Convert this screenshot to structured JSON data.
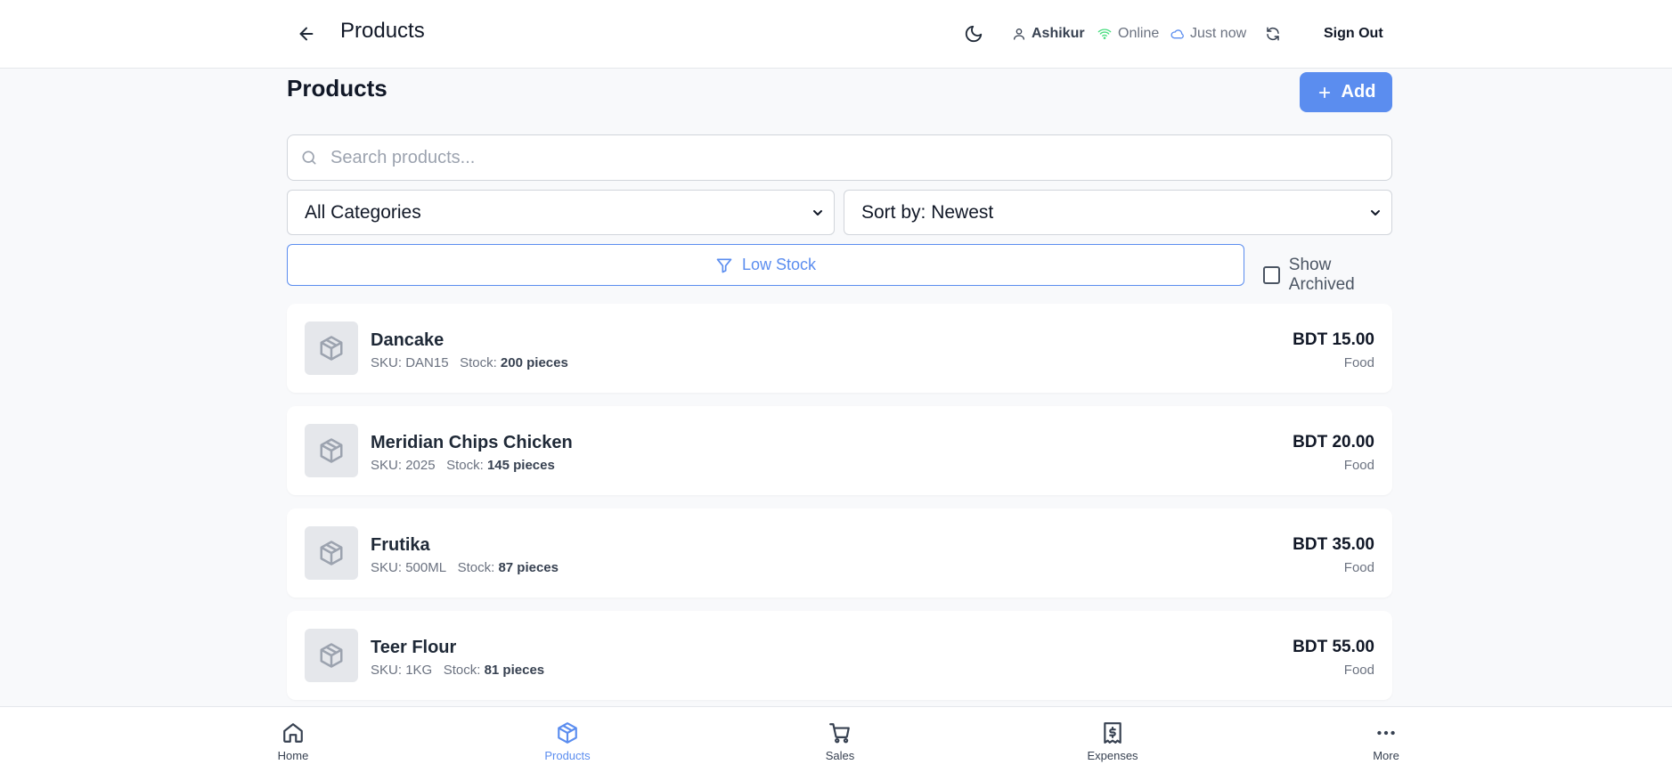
{
  "header": {
    "title": "Products",
    "user": "Ashikur",
    "status": "Online",
    "sync": "Just now",
    "signout": "Sign Out"
  },
  "main": {
    "title": "Products",
    "add_label": "Add",
    "search_placeholder": "Search products...",
    "category_select": "All Categories",
    "sort_select": "Sort by: Newest",
    "low_stock_label": "Low Stock",
    "show_archived_label": "Show Archived"
  },
  "products": [
    {
      "name": "Dancake",
      "sku_label": "SKU:",
      "sku": "DAN15",
      "stock_label": "Stock:",
      "stock": "200 pieces",
      "price": "BDT 15.00",
      "category": "Food"
    },
    {
      "name": "Meridian Chips Chicken",
      "sku_label": "SKU:",
      "sku": "2025",
      "stock_label": "Stock:",
      "stock": "145 pieces",
      "price": "BDT 20.00",
      "category": "Food"
    },
    {
      "name": "Frutika",
      "sku_label": "SKU:",
      "sku": "500ML",
      "stock_label": "Stock:",
      "stock": "87 pieces",
      "price": "BDT 35.00",
      "category": "Food"
    },
    {
      "name": "Teer Flour",
      "sku_label": "SKU:",
      "sku": "1KG",
      "stock_label": "Stock:",
      "stock": "81 pieces",
      "price": "BDT 55.00",
      "category": "Food"
    }
  ],
  "nav": [
    {
      "label": "Home",
      "icon": "home-icon"
    },
    {
      "label": "Products",
      "icon": "box-icon",
      "active": true
    },
    {
      "label": "Sales",
      "icon": "cart-icon"
    },
    {
      "label": "Expenses",
      "icon": "receipt-icon"
    },
    {
      "label": "More",
      "icon": "more-icon"
    }
  ],
  "colors": {
    "accent": "#5b8def",
    "online": "#4ade80",
    "sync": "#5b8def"
  }
}
